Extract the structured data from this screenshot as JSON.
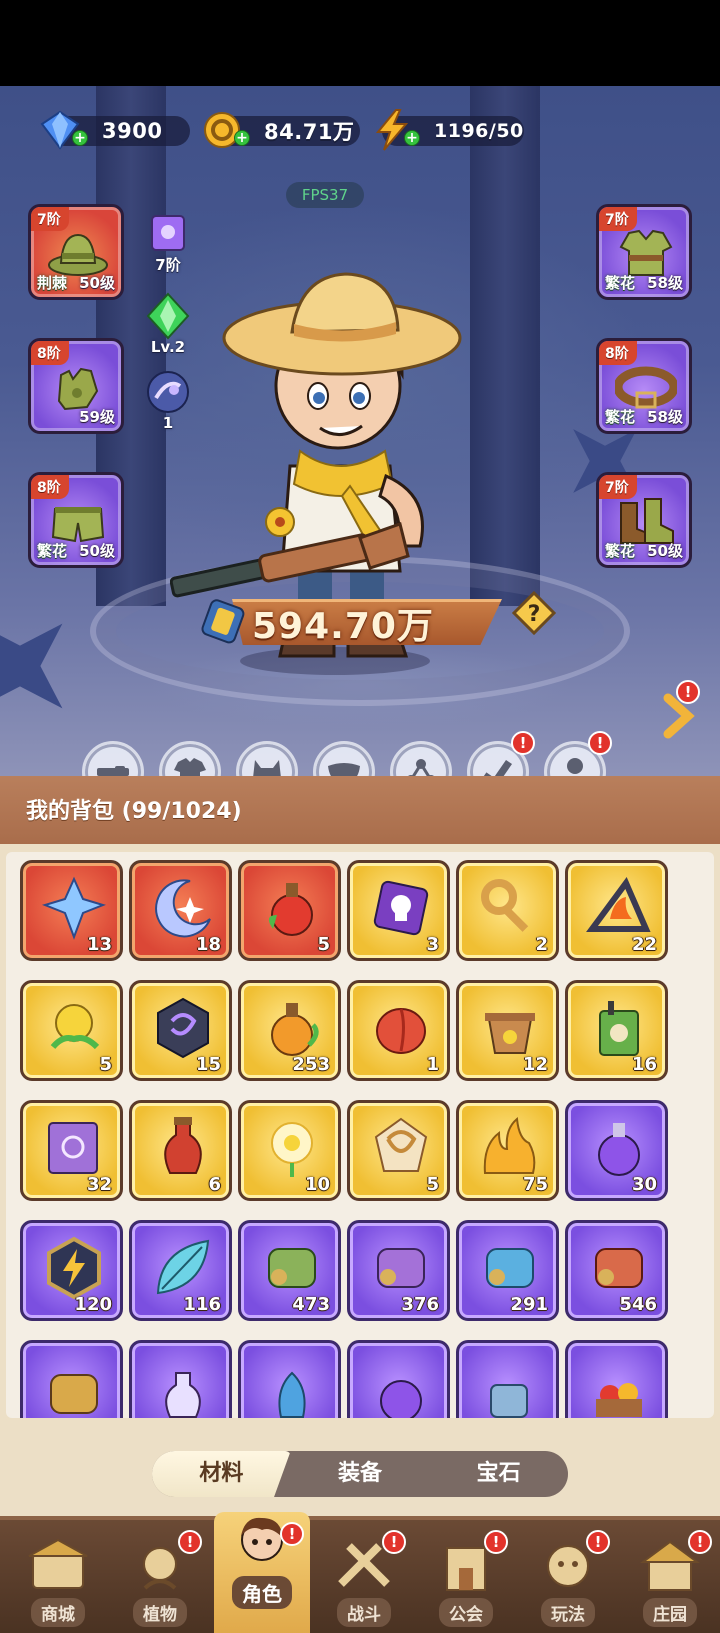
{
  "currency": {
    "gems": "3900",
    "gold": "84.71万",
    "energy": "1196/50"
  },
  "fps": "FPS37",
  "equipment_left": [
    {
      "tier": "7阶",
      "set": "荆棘",
      "level": "50级",
      "rarity": "red",
      "icon": "hat-icon"
    },
    {
      "tier": "8阶",
      "set": "",
      "level": "59级",
      "rarity": "purple",
      "icon": "glove-icon"
    },
    {
      "tier": "8阶",
      "set": "繁花",
      "level": "50级",
      "rarity": "purple",
      "icon": "pants-icon"
    }
  ],
  "equipment_right": [
    {
      "tier": "7阶",
      "set": "繁花",
      "level": "58级",
      "rarity": "purple",
      "icon": "vest-icon"
    },
    {
      "tier": "8阶",
      "set": "繁花",
      "level": "58级",
      "rarity": "purple",
      "icon": "belt-icon"
    },
    {
      "tier": "7阶",
      "set": "繁花",
      "level": "50级",
      "rarity": "purple",
      "icon": "boots-icon"
    }
  ],
  "mini_stats": {
    "scroll_tier": "7阶",
    "crystal_level": "Lv.2",
    "orb_count": "1"
  },
  "power": "594.70万",
  "features": [
    {
      "label": "武器",
      "icon": "weapon-icon",
      "badge": false
    },
    {
      "label": "时装",
      "icon": "outfit-icon",
      "badge": false
    },
    {
      "label": "宠物",
      "icon": "pet-icon",
      "badge": false
    },
    {
      "label": "装饰",
      "icon": "mask-icon",
      "badge": false
    },
    {
      "label": "天赋",
      "icon": "talent-icon",
      "badge": false
    },
    {
      "label": "装备",
      "icon": "equip-icon",
      "badge": true
    },
    {
      "label": "体魄",
      "icon": "body-icon",
      "badge": true
    }
  ],
  "bag": {
    "title": "我的背包 (99/1024)",
    "items": [
      {
        "rarity": "red",
        "icon": "star-crystal-icon",
        "count": "13"
      },
      {
        "rarity": "red",
        "icon": "moon-star-icon",
        "count": "18"
      },
      {
        "rarity": "red",
        "icon": "red-potion-icon",
        "count": "5"
      },
      {
        "rarity": "gold",
        "icon": "skull-scroll-icon",
        "count": "3"
      },
      {
        "rarity": "gold",
        "icon": "key-icon",
        "count": "2"
      },
      {
        "rarity": "gold",
        "icon": "flame-prism-icon",
        "count": "22"
      },
      {
        "rarity": "gold",
        "icon": "golden-rose-icon",
        "count": "5"
      },
      {
        "rarity": "gold",
        "icon": "rune-stone-icon",
        "count": "15"
      },
      {
        "rarity": "gold",
        "icon": "orange-potion-icon",
        "count": "253"
      },
      {
        "rarity": "gold",
        "icon": "red-bud-icon",
        "count": "1"
      },
      {
        "rarity": "gold",
        "icon": "flower-pot-icon",
        "count": "12"
      },
      {
        "rarity": "gold",
        "icon": "herbicide-icon",
        "count": "16"
      },
      {
        "rarity": "gold",
        "icon": "spell-book-icon",
        "count": "32"
      },
      {
        "rarity": "gold",
        "icon": "red-flask-icon",
        "count": "6"
      },
      {
        "rarity": "gold",
        "icon": "glow-flower-icon",
        "count": "10"
      },
      {
        "rarity": "gold",
        "icon": "knot-rune-icon",
        "count": "5"
      },
      {
        "rarity": "gold",
        "icon": "golden-fire-icon",
        "count": "75"
      },
      {
        "rarity": "purple",
        "icon": "purple-potion-icon",
        "count": "30"
      },
      {
        "rarity": "purple",
        "icon": "bolt-badge-icon",
        "count": "120"
      },
      {
        "rarity": "purple",
        "icon": "blue-leaf-icon",
        "count": "116"
      },
      {
        "rarity": "purple",
        "icon": "green-scroll-icon",
        "count": "473"
      },
      {
        "rarity": "purple",
        "icon": "purple-scroll-icon",
        "count": "376"
      },
      {
        "rarity": "purple",
        "icon": "blue-scroll-icon",
        "count": "291"
      },
      {
        "rarity": "purple",
        "icon": "red-scroll-icon",
        "count": "546"
      },
      {
        "rarity": "purple",
        "icon": "gold-scroll-icon",
        "count": ""
      },
      {
        "rarity": "purple",
        "icon": "flask-icon",
        "count": ""
      },
      {
        "rarity": "purple",
        "icon": "blue-gem-icon",
        "count": ""
      },
      {
        "rarity": "purple",
        "icon": "purple-bulb-icon",
        "count": ""
      },
      {
        "rarity": "purple",
        "icon": "watering-can-icon",
        "count": ""
      },
      {
        "rarity": "purple",
        "icon": "fruit-basket-icon",
        "count": ""
      }
    ]
  },
  "tabs": [
    "材料",
    "装备",
    "宝石"
  ],
  "active_tab": "材料",
  "nav": [
    {
      "label": "商城",
      "icon": "shop-icon",
      "badge": false
    },
    {
      "label": "植物",
      "icon": "plant-icon",
      "badge": true
    },
    {
      "label": "角色",
      "icon": "character-icon",
      "badge": true,
      "active": true
    },
    {
      "label": "战斗",
      "icon": "battle-icon",
      "badge": true
    },
    {
      "label": "公会",
      "icon": "guild-icon",
      "badge": true
    },
    {
      "label": "玩法",
      "icon": "gameplay-icon",
      "badge": true
    },
    {
      "label": "庄园",
      "icon": "manor-icon",
      "badge": true
    }
  ],
  "colors": {
    "red_rarity": "#db4736",
    "gold_rarity": "#f0bf33",
    "purple_rarity": "#7b4fe0",
    "badge": "#e2332b",
    "bag_header": "#b07453"
  }
}
